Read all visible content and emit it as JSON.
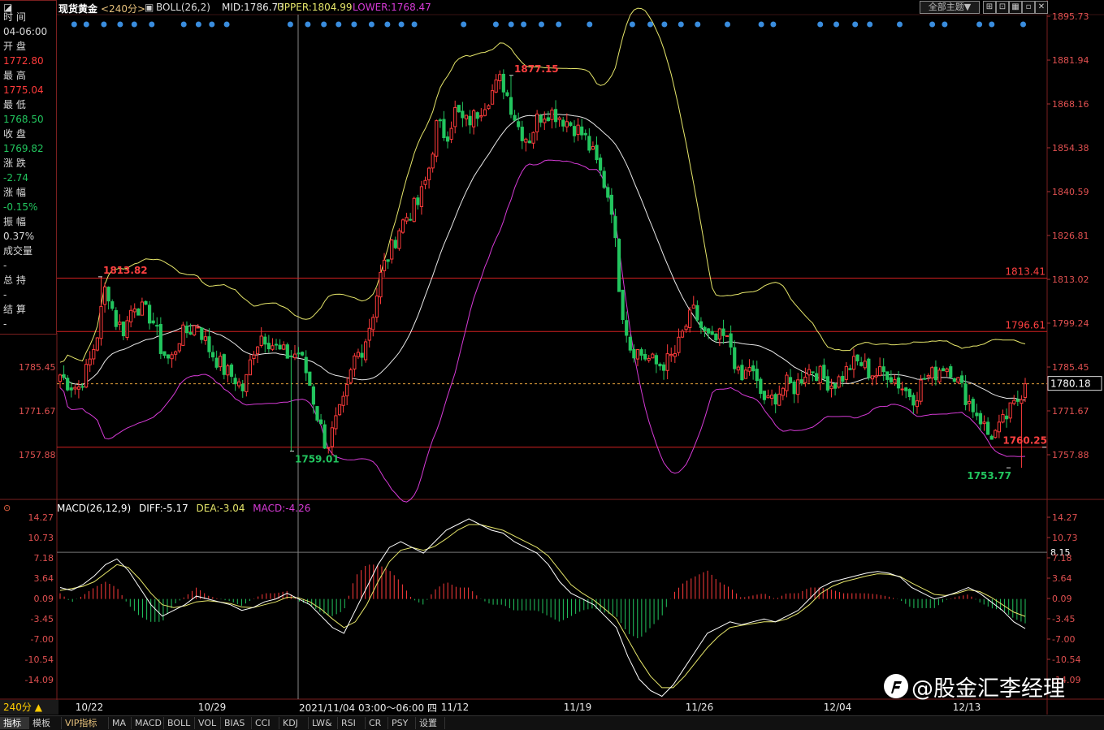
{
  "toolbar": {
    "symbol": "现货黄金",
    "period_tag": "<240分>",
    "boll_label": "BOLL(26,2)",
    "mid_label": "MID:1786.73",
    "upper_label": "UPPER:1804.99",
    "lower_label": "LOWER:1768.47",
    "theme_button": "全部主题▼"
  },
  "info_panel": {
    "time_key": "时 间",
    "time_val": "04-06:00",
    "open_key": "开 盘",
    "open_val": "1772.80",
    "high_key": "最 高",
    "high_val": "1775.04",
    "low_key": "最 低",
    "low_val": "1768.50",
    "close_key": "收 盘",
    "close_val": "1769.82",
    "change_key": "涨 跌",
    "change_val": "-2.74",
    "pct_key": "涨 幅",
    "pct_val": "-0.15%",
    "amp_key": "振 幅",
    "amp_val": "0.37%",
    "vol_key": "成交量",
    "vol_val": "-",
    "hold_key": "总 持",
    "hold_val": "-",
    "settle_key": "结 算",
    "settle_val": "-"
  },
  "macd_bar": {
    "label": "MACD(26,12,9)",
    "diff": "DIFF:-5.17",
    "dea": "DEA:-3.04",
    "macd": "MACD:-4.26"
  },
  "period_selector": "240分 ▲",
  "crosshair_label": "2021/11/04 03:00～06:00 四",
  "watermark": "@股金汇李经理",
  "tabs": [
    "指标",
    "模板",
    "VIP指标",
    "MA",
    "MACD",
    "BOLL",
    "VOL",
    "BIAS",
    "CCI",
    "KDJ",
    "LW&",
    "RSI",
    "CR",
    "PSY",
    "设置"
  ],
  "colors": {
    "up": "#ff3b3b",
    "down": "#22c55e",
    "boll_mid": "#e8e8e8",
    "boll_upper": "#e6e66a",
    "boll_lower": "#d63ad6",
    "hline": "#d42020",
    "dot": "#3a8dde"
  },
  "chart_data": [
    {
      "type": "candlestick",
      "title": "现货黄金 240分",
      "price_axis_ticks": [
        "1895.73",
        "1881.94",
        "1868.16",
        "1854.38",
        "1840.59",
        "1826.81",
        "1813.02",
        "1799.24",
        "1785.45",
        "1771.67",
        "1757.88"
      ],
      "left_axis_ticks": [
        "1785.45",
        "1771.67",
        "1757.88"
      ],
      "ylim": [
        1755.5,
        1898.5
      ],
      "date_labels": [
        "10/22",
        "10/29",
        "11/12",
        "11/19",
        "11/26",
        "12/04",
        "12/13"
      ],
      "annotations": [
        {
          "text": "1813.82",
          "value": 1813.82
        },
        {
          "text": "1759.01",
          "value": 1759.01
        },
        {
          "text": "1877.15",
          "value": 1877.15
        },
        {
          "text": "1760.25",
          "value": 1760.25
        },
        {
          "text": "1753.77",
          "value": 1753.77
        }
      ],
      "horizontal_lines": [
        {
          "label": "1813.41",
          "value": 1813.41
        },
        {
          "label": "1796.61",
          "value": 1796.61
        },
        {
          "label": "",
          "value": 1760.25
        }
      ],
      "current_price": "1780.18",
      "current_value": 1780.18,
      "price_path": [
        1783,
        1780,
        1779,
        1785,
        1795,
        1812,
        1800,
        1797,
        1806,
        1803,
        1801,
        1791,
        1787,
        1795,
        1797,
        1799,
        1792,
        1788,
        1784,
        1782,
        1778,
        1791,
        1796,
        1793,
        1790,
        1789,
        1790,
        1782,
        1770,
        1760,
        1768,
        1775,
        1788,
        1792,
        1802,
        1816,
        1822,
        1830,
        1834,
        1837,
        1846,
        1862,
        1858,
        1866,
        1862,
        1864,
        1868,
        1872,
        1876,
        1868,
        1860,
        1857,
        1864,
        1866,
        1865,
        1863,
        1861,
        1858,
        1852,
        1845,
        1836,
        1806,
        1792,
        1790,
        1788,
        1786,
        1787,
        1790,
        1798,
        1803,
        1796,
        1793,
        1795,
        1792,
        1780,
        1786,
        1778,
        1774,
        1777,
        1780,
        1779,
        1784,
        1785,
        1782,
        1780,
        1782,
        1786,
        1787,
        1784,
        1783,
        1784,
        1781,
        1778,
        1776,
        1782,
        1783,
        1786,
        1785,
        1779,
        1774,
        1770,
        1764,
        1765,
        1770,
        1774,
        1780.18
      ]
    },
    {
      "type": "macd",
      "title": "MACD(26,12,9)",
      "ticks": [
        "14.27",
        "10.73",
        "7.18",
        "3.64",
        "0.09",
        "-3.45",
        "-7.00",
        "-10.54",
        "-14.09"
      ],
      "ylim": [
        -17.0,
        15.5
      ],
      "level_label": "8.15",
      "level_value": 8.15,
      "diff": [
        2,
        1.5,
        2.5,
        4,
        6,
        7,
        5,
        2,
        -1,
        -3,
        -2,
        -1,
        0.5,
        0,
        -0.5,
        -1,
        -2,
        -1.5,
        -0.5,
        0,
        1,
        0,
        -1,
        -3,
        -5,
        -6,
        -2,
        2,
        6,
        9,
        10,
        9,
        8,
        10,
        12,
        13,
        14,
        13,
        12,
        11.5,
        10,
        9,
        8,
        6,
        3,
        1,
        0,
        -1,
        -3,
        -5,
        -10,
        -14,
        -16,
        -17,
        -15,
        -12,
        -9,
        -6,
        -5,
        -4,
        -4.5,
        -4,
        -3.5,
        -4,
        -3,
        -2,
        0,
        2,
        3,
        3.5,
        4,
        4.5,
        4.8,
        4.5,
        3.8,
        2,
        1,
        0,
        0.5,
        1.2,
        2,
        1,
        -0.5,
        -2,
        -4,
        -5.17
      ],
      "dea": [
        1.5,
        1.8,
        2.2,
        3,
        4.5,
        6,
        5.5,
        3.5,
        1,
        -1,
        -1.5,
        -1.2,
        -0.5,
        -0.3,
        -0.5,
        -0.8,
        -1.4,
        -1.5,
        -1,
        -0.5,
        0.3,
        0.2,
        -0.5,
        -1.8,
        -3.5,
        -5,
        -4,
        -1,
        3,
        6.5,
        8.5,
        9,
        8.5,
        9.2,
        10.5,
        12,
        13,
        13,
        12.5,
        12,
        11,
        10,
        9,
        7.5,
        5,
        2.5,
        1,
        -0.2,
        -1.8,
        -3.5,
        -7,
        -10.5,
        -13.5,
        -15.5,
        -15.5,
        -13.5,
        -11,
        -8.5,
        -6.5,
        -5,
        -4.6,
        -4.3,
        -4,
        -4,
        -3.5,
        -2.5,
        -1,
        1,
        2.2,
        3,
        3.5,
        4,
        4.4,
        4.3,
        3.9,
        2.8,
        1.8,
        0.8,
        0.6,
        1,
        1.6,
        1.3,
        0.3,
        -1,
        -2.3,
        -3.04
      ],
      "hist": [
        0.5,
        -0.3,
        0.3,
        1,
        1.5,
        1,
        -0.5,
        -1.5,
        -2,
        -2,
        -0.5,
        0.2,
        1,
        0.3,
        0,
        -0.2,
        -0.6,
        0,
        0.5,
        0.5,
        0.7,
        -0.2,
        -0.5,
        -1.2,
        -1.5,
        -1,
        2,
        3,
        3,
        2.5,
        1.5,
        0,
        -0.5,
        0.8,
        1.5,
        1,
        1,
        0,
        -0.5,
        -0.5,
        -1,
        -1,
        -1,
        -1.5,
        -2,
        -1.5,
        -1,
        -0.8,
        -1.2,
        -1.5,
        -3,
        -3.5,
        -2.5,
        -1.5,
        0.5,
        1.5,
        2,
        2.5,
        1.5,
        1,
        0.1,
        0.3,
        0.5,
        0,
        0.5,
        0.5,
        1,
        1,
        0.8,
        0.5,
        0.5,
        0.5,
        0.4,
        0.2,
        -0.1,
        -0.8,
        -0.8,
        -0.8,
        -0.1,
        0.2,
        0.4,
        -0.3,
        -0.8,
        -1,
        -1.7,
        -2.13
      ]
    }
  ]
}
